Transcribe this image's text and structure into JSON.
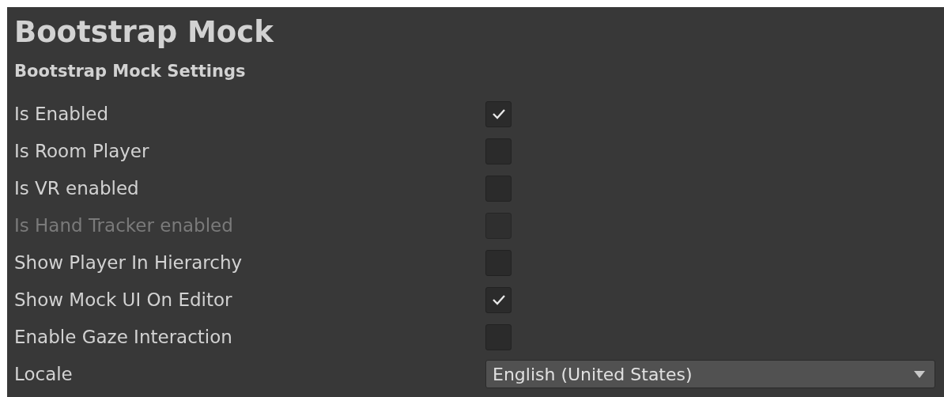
{
  "title": "Bootstrap Mock",
  "section": "Bootstrap Mock Settings",
  "rows": [
    {
      "kind": "checkbox",
      "label": "Is Enabled",
      "checked": true,
      "disabled": false
    },
    {
      "kind": "checkbox",
      "label": "Is Room Player",
      "checked": false,
      "disabled": false
    },
    {
      "kind": "checkbox",
      "label": "Is VR enabled",
      "checked": false,
      "disabled": false
    },
    {
      "kind": "checkbox",
      "label": "Is Hand Tracker enabled",
      "checked": false,
      "disabled": true
    },
    {
      "kind": "checkbox",
      "label": "Show Player In Hierarchy",
      "checked": false,
      "disabled": false
    },
    {
      "kind": "checkbox",
      "label": "Show Mock UI On Editor",
      "checked": true,
      "disabled": false
    },
    {
      "kind": "checkbox",
      "label": "Enable Gaze Interaction",
      "checked": false,
      "disabled": false
    },
    {
      "kind": "dropdown",
      "label": "Locale",
      "value": "English (United States)"
    }
  ]
}
